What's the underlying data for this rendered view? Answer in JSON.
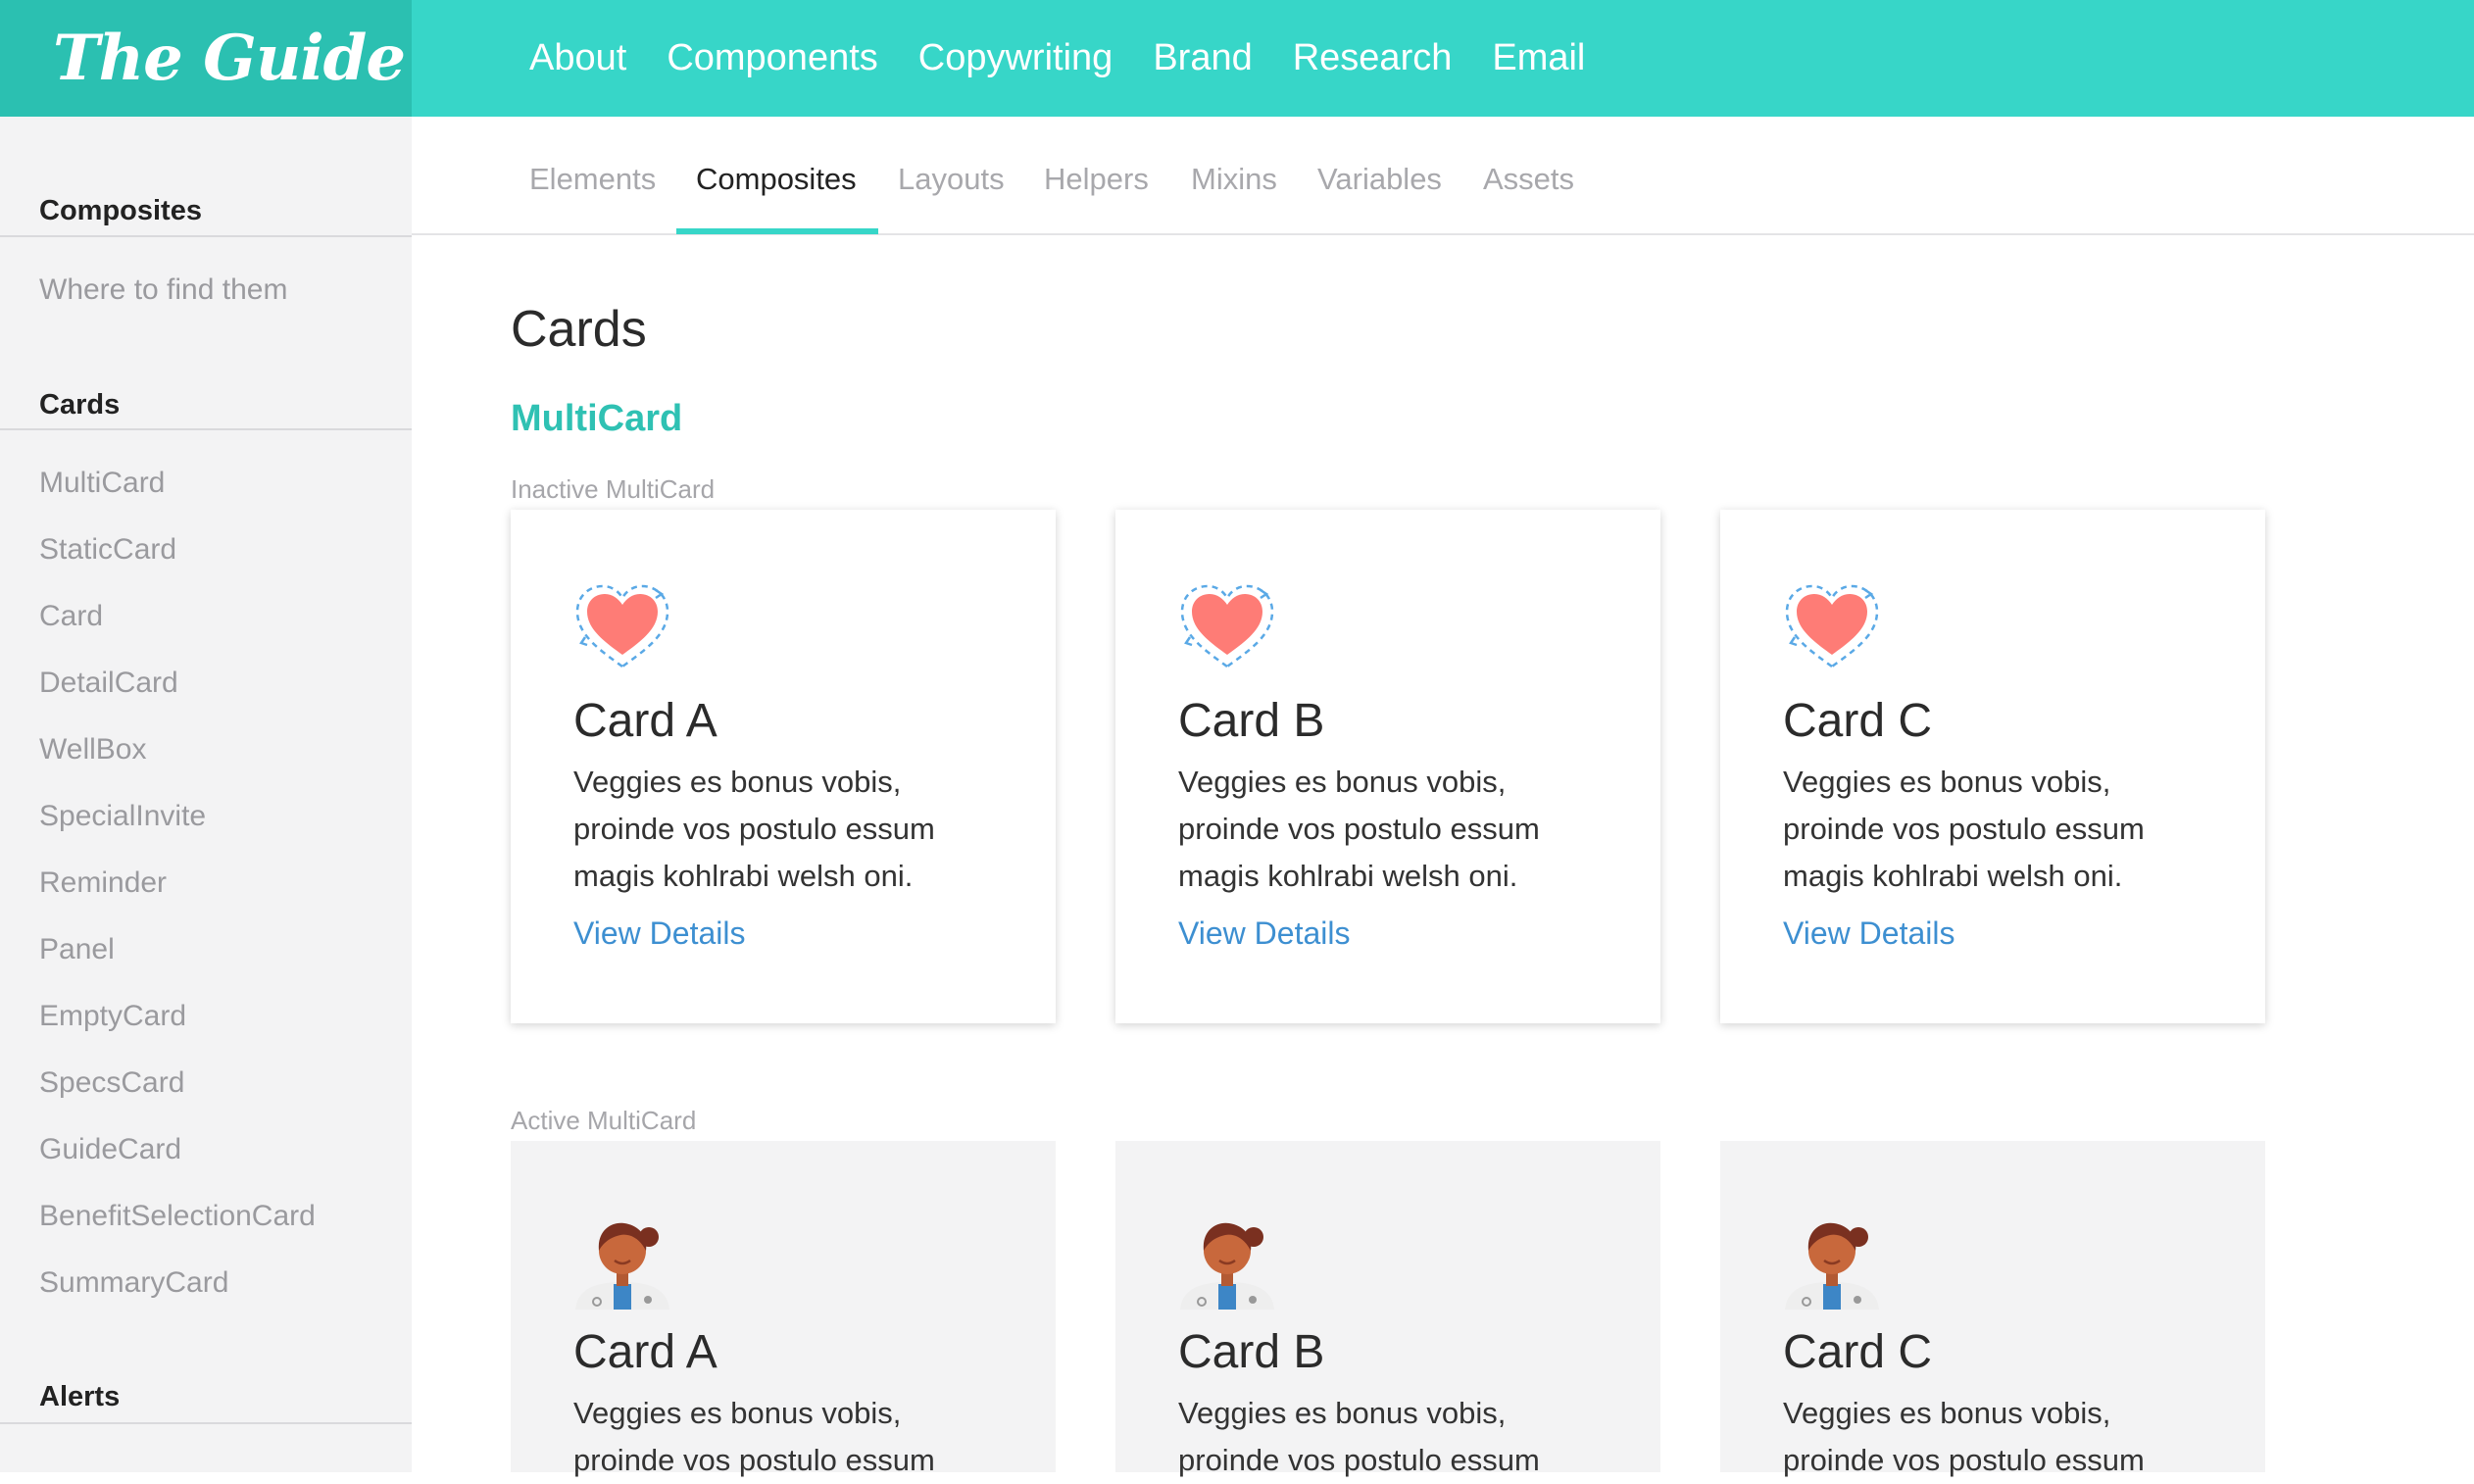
{
  "header": {
    "logo": "The Guide",
    "nav": [
      "About",
      "Components",
      "Copywriting",
      "Brand",
      "Research",
      "Email"
    ]
  },
  "subnav": {
    "tabs": [
      "Elements",
      "Composites",
      "Layouts",
      "Helpers",
      "Mixins",
      "Variables",
      "Assets"
    ],
    "active": "Composites"
  },
  "sidebar": {
    "composites": {
      "heading": "Composites",
      "items": [
        "Where to find them"
      ]
    },
    "cards": {
      "heading": "Cards",
      "items": [
        "MultiCard",
        "StaticCard",
        "Card",
        "DetailCard",
        "WellBox",
        "SpecialInvite",
        "Reminder",
        "Panel",
        "EmptyCard",
        "SpecsCard",
        "GuideCard",
        "BenefitSelectionCard",
        "SummaryCard"
      ]
    },
    "alerts": {
      "heading": "Alerts"
    }
  },
  "main": {
    "title": "Cards",
    "section": "MultiCard",
    "inactive_label": "Inactive MultiCard",
    "active_label": "Active MultiCard",
    "inactive_cards": [
      {
        "title": "Card A",
        "body": "Veggies es bonus vobis, proinde vos postulo essum magis kohlrabi welsh oni.",
        "link": "View Details",
        "icon": "heart-icon"
      },
      {
        "title": "Card B",
        "body": "Veggies es bonus vobis, proinde vos postulo essum magis kohlrabi welsh oni.",
        "link": "View Details",
        "icon": "heart-icon"
      },
      {
        "title": "Card C",
        "body": "Veggies es bonus vobis, proinde vos postulo essum magis kohlrabi welsh oni.",
        "link": "View Details",
        "icon": "heart-icon"
      }
    ],
    "active_cards": [
      {
        "title": "Card A",
        "body": "Veggies es bonus vobis, proinde vos postulo essum",
        "icon": "doctor-avatar-icon"
      },
      {
        "title": "Card B",
        "body": "Veggies es bonus vobis, proinde vos postulo essum",
        "icon": "doctor-avatar-icon"
      },
      {
        "title": "Card C",
        "body": "Veggies es bonus vobis, proinde vos postulo essum",
        "icon": "doctor-avatar-icon"
      }
    ]
  },
  "colors": {
    "brand": "#37d6c8",
    "brand_dark": "#2bc0b1",
    "accent_text": "#2fc1b3",
    "link": "#3d8fd1"
  }
}
